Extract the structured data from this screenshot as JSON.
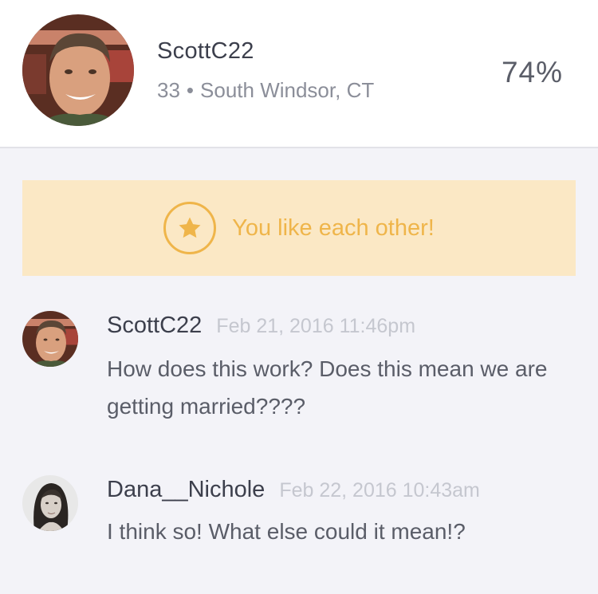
{
  "profile": {
    "username": "ScottC22",
    "age": "33",
    "separator": "•",
    "location": "South Windsor, CT",
    "match_percent": "74%"
  },
  "banner": {
    "text": "You like each other!",
    "icon": "star-icon",
    "color": "#efb54a",
    "background": "#fbe8c5"
  },
  "messages": [
    {
      "author": "ScottC22",
      "timestamp": "Feb 21, 2016 11:46pm",
      "text": "How does this work? Does this mean we are getting married????"
    },
    {
      "author": "Dana__Nichole",
      "timestamp": "Feb 22, 2016 10:43am",
      "text": "I think so! What else could it mean!?"
    }
  ]
}
